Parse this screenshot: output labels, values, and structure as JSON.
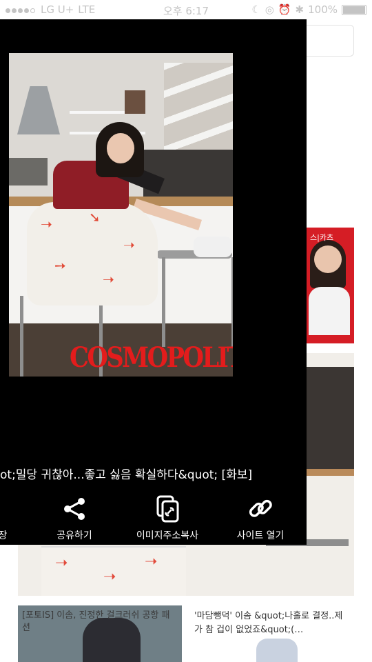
{
  "statusbar": {
    "carrier": "LG U+",
    "network": "LTE",
    "time": "오후 6:17",
    "battery": "100%"
  },
  "background": {
    "thumb_label": "스|카츠",
    "card1_title": "[포토IS] 이솜, 진정한 걸크러쉬 공항 패션",
    "card2_title": "'마담뺑덕' 이솜 &quot;나홀로 결정..제가 참 겁이 없었죠&quot;(…"
  },
  "viewer": {
    "photo_brand": "COSMOPOLITAN",
    "caption": "ot;밀당 귀찮아...좋고 싫음 확실하다&quot; [화보]",
    "actions": {
      "save_partial": "장",
      "share": "공유하기",
      "copy_image_url": "이미지주소복사",
      "open_site": "사이트 열기"
    }
  },
  "colors": {
    "overlay": "#000000",
    "brand_red": "#e31c1c",
    "status_text": "#c4c4c4"
  }
}
